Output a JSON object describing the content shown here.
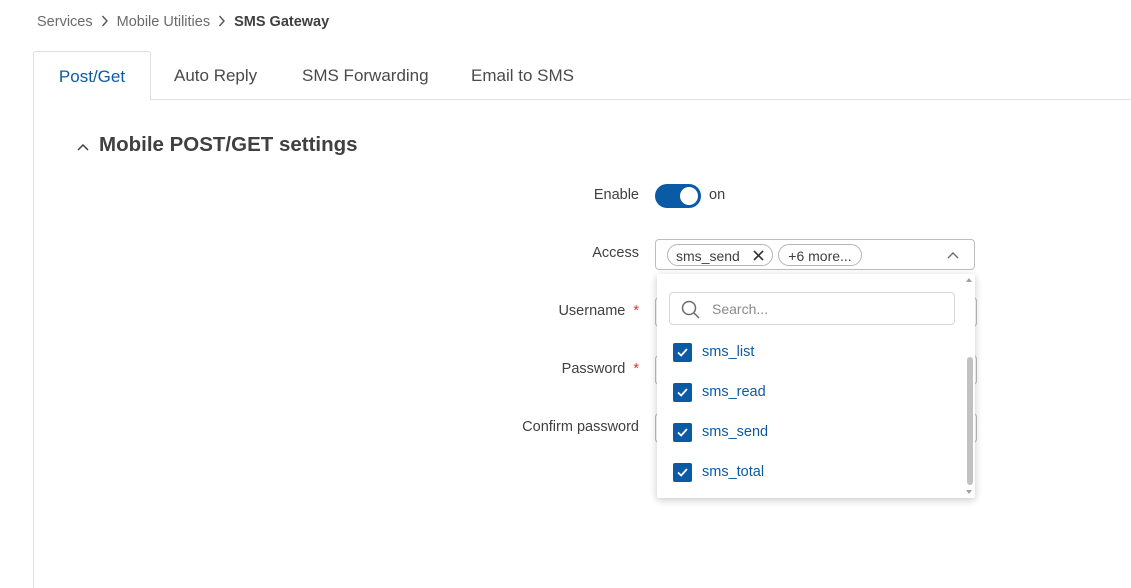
{
  "breadcrumb": {
    "items": [
      "Services",
      "Mobile Utilities"
    ],
    "current": "SMS Gateway"
  },
  "tabs": [
    {
      "label": "Post/Get",
      "active": true
    },
    {
      "label": "Auto Reply",
      "active": false
    },
    {
      "label": "SMS Forwarding",
      "active": false
    },
    {
      "label": "Email to SMS",
      "active": false
    }
  ],
  "section": {
    "title": "Mobile POST/GET settings"
  },
  "form": {
    "enable": {
      "label": "Enable",
      "state": "on"
    },
    "access": {
      "label": "Access",
      "chips": {
        "first": "sms_send",
        "more": "+6 more..."
      }
    },
    "username": {
      "label": "Username",
      "required_mark": "*"
    },
    "password": {
      "label": "Password",
      "required_mark": "*"
    },
    "confirm_password": {
      "label": "Confirm password"
    }
  },
  "dropdown": {
    "search_placeholder": "Search...",
    "options": [
      {
        "label": "sms_list",
        "checked": true
      },
      {
        "label": "sms_read",
        "checked": true
      },
      {
        "label": "sms_send",
        "checked": true
      },
      {
        "label": "sms_total",
        "checked": true
      }
    ]
  },
  "colors": {
    "accent": "#0b5aa6",
    "required": "#d9382c",
    "text": "#404040"
  }
}
